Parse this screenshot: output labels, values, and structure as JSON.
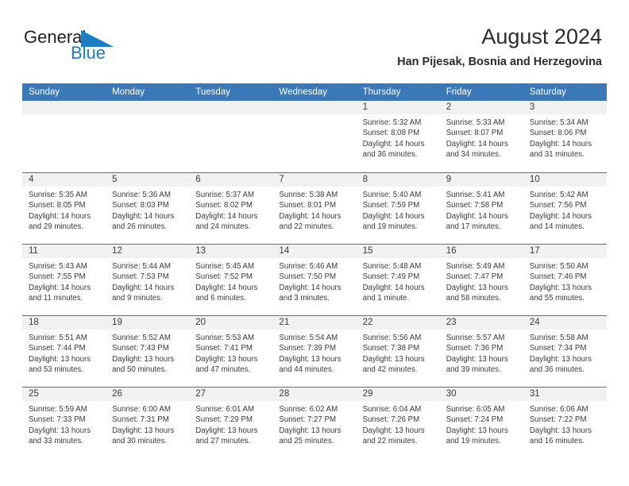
{
  "logo": {
    "word1": "General",
    "word2": "Blue",
    "triangle_color": "#1f7dc4",
    "blue_color": "#1f7dc4",
    "black_color": "#231f20"
  },
  "header": {
    "title": "August 2024",
    "subtitle": "Han Pijesak, Bosnia and Herzegovina"
  },
  "theme": {
    "header_blue": "#3b78b8",
    "band_gray": "#f1f1f1",
    "text": "#3a3a3a"
  },
  "calendar": {
    "weekday_headers": [
      "Sunday",
      "Monday",
      "Tuesday",
      "Wednesday",
      "Thursday",
      "Friday",
      "Saturday"
    ],
    "weeks": [
      [
        {
          "day": "",
          "lines": []
        },
        {
          "day": "",
          "lines": []
        },
        {
          "day": "",
          "lines": []
        },
        {
          "day": "",
          "lines": []
        },
        {
          "day": "1",
          "lines": [
            "Sunrise: 5:32 AM",
            "Sunset: 8:08 PM",
            "Daylight: 14 hours",
            "and 36 minutes."
          ]
        },
        {
          "day": "2",
          "lines": [
            "Sunrise: 5:33 AM",
            "Sunset: 8:07 PM",
            "Daylight: 14 hours",
            "and 34 minutes."
          ]
        },
        {
          "day": "3",
          "lines": [
            "Sunrise: 5:34 AM",
            "Sunset: 8:06 PM",
            "Daylight: 14 hours",
            "and 31 minutes."
          ]
        }
      ],
      [
        {
          "day": "4",
          "lines": [
            "Sunrise: 5:35 AM",
            "Sunset: 8:05 PM",
            "Daylight: 14 hours",
            "and 29 minutes."
          ]
        },
        {
          "day": "5",
          "lines": [
            "Sunrise: 5:36 AM",
            "Sunset: 8:03 PM",
            "Daylight: 14 hours",
            "and 26 minutes."
          ]
        },
        {
          "day": "6",
          "lines": [
            "Sunrise: 5:37 AM",
            "Sunset: 8:02 PM",
            "Daylight: 14 hours",
            "and 24 minutes."
          ]
        },
        {
          "day": "7",
          "lines": [
            "Sunrise: 5:38 AM",
            "Sunset: 8:01 PM",
            "Daylight: 14 hours",
            "and 22 minutes."
          ]
        },
        {
          "day": "8",
          "lines": [
            "Sunrise: 5:40 AM",
            "Sunset: 7:59 PM",
            "Daylight: 14 hours",
            "and 19 minutes."
          ]
        },
        {
          "day": "9",
          "lines": [
            "Sunrise: 5:41 AM",
            "Sunset: 7:58 PM",
            "Daylight: 14 hours",
            "and 17 minutes."
          ]
        },
        {
          "day": "10",
          "lines": [
            "Sunrise: 5:42 AM",
            "Sunset: 7:56 PM",
            "Daylight: 14 hours",
            "and 14 minutes."
          ]
        }
      ],
      [
        {
          "day": "11",
          "lines": [
            "Sunrise: 5:43 AM",
            "Sunset: 7:55 PM",
            "Daylight: 14 hours",
            "and 11 minutes."
          ]
        },
        {
          "day": "12",
          "lines": [
            "Sunrise: 5:44 AM",
            "Sunset: 7:53 PM",
            "Daylight: 14 hours",
            "and 9 minutes."
          ]
        },
        {
          "day": "13",
          "lines": [
            "Sunrise: 5:45 AM",
            "Sunset: 7:52 PM",
            "Daylight: 14 hours",
            "and 6 minutes."
          ]
        },
        {
          "day": "14",
          "lines": [
            "Sunrise: 5:46 AM",
            "Sunset: 7:50 PM",
            "Daylight: 14 hours",
            "and 3 minutes."
          ]
        },
        {
          "day": "15",
          "lines": [
            "Sunrise: 5:48 AM",
            "Sunset: 7:49 PM",
            "Daylight: 14 hours",
            "and 1 minute."
          ]
        },
        {
          "day": "16",
          "lines": [
            "Sunrise: 5:49 AM",
            "Sunset: 7:47 PM",
            "Daylight: 13 hours",
            "and 58 minutes."
          ]
        },
        {
          "day": "17",
          "lines": [
            "Sunrise: 5:50 AM",
            "Sunset: 7:46 PM",
            "Daylight: 13 hours",
            "and 55 minutes."
          ]
        }
      ],
      [
        {
          "day": "18",
          "lines": [
            "Sunrise: 5:51 AM",
            "Sunset: 7:44 PM",
            "Daylight: 13 hours",
            "and 53 minutes."
          ]
        },
        {
          "day": "19",
          "lines": [
            "Sunrise: 5:52 AM",
            "Sunset: 7:43 PM",
            "Daylight: 13 hours",
            "and 50 minutes."
          ]
        },
        {
          "day": "20",
          "lines": [
            "Sunrise: 5:53 AM",
            "Sunset: 7:41 PM",
            "Daylight: 13 hours",
            "and 47 minutes."
          ]
        },
        {
          "day": "21",
          "lines": [
            "Sunrise: 5:54 AM",
            "Sunset: 7:39 PM",
            "Daylight: 13 hours",
            "and 44 minutes."
          ]
        },
        {
          "day": "22",
          "lines": [
            "Sunrise: 5:56 AM",
            "Sunset: 7:38 PM",
            "Daylight: 13 hours",
            "and 42 minutes."
          ]
        },
        {
          "day": "23",
          "lines": [
            "Sunrise: 5:57 AM",
            "Sunset: 7:36 PM",
            "Daylight: 13 hours",
            "and 39 minutes."
          ]
        },
        {
          "day": "24",
          "lines": [
            "Sunrise: 5:58 AM",
            "Sunset: 7:34 PM",
            "Daylight: 13 hours",
            "and 36 minutes."
          ]
        }
      ],
      [
        {
          "day": "25",
          "lines": [
            "Sunrise: 5:59 AM",
            "Sunset: 7:33 PM",
            "Daylight: 13 hours",
            "and 33 minutes."
          ]
        },
        {
          "day": "26",
          "lines": [
            "Sunrise: 6:00 AM",
            "Sunset: 7:31 PM",
            "Daylight: 13 hours",
            "and 30 minutes."
          ]
        },
        {
          "day": "27",
          "lines": [
            "Sunrise: 6:01 AM",
            "Sunset: 7:29 PM",
            "Daylight: 13 hours",
            "and 27 minutes."
          ]
        },
        {
          "day": "28",
          "lines": [
            "Sunrise: 6:02 AM",
            "Sunset: 7:27 PM",
            "Daylight: 13 hours",
            "and 25 minutes."
          ]
        },
        {
          "day": "29",
          "lines": [
            "Sunrise: 6:04 AM",
            "Sunset: 7:26 PM",
            "Daylight: 13 hours",
            "and 22 minutes."
          ]
        },
        {
          "day": "30",
          "lines": [
            "Sunrise: 6:05 AM",
            "Sunset: 7:24 PM",
            "Daylight: 13 hours",
            "and 19 minutes."
          ]
        },
        {
          "day": "31",
          "lines": [
            "Sunrise: 6:06 AM",
            "Sunset: 7:22 PM",
            "Daylight: 13 hours",
            "and 16 minutes."
          ]
        }
      ]
    ]
  }
}
